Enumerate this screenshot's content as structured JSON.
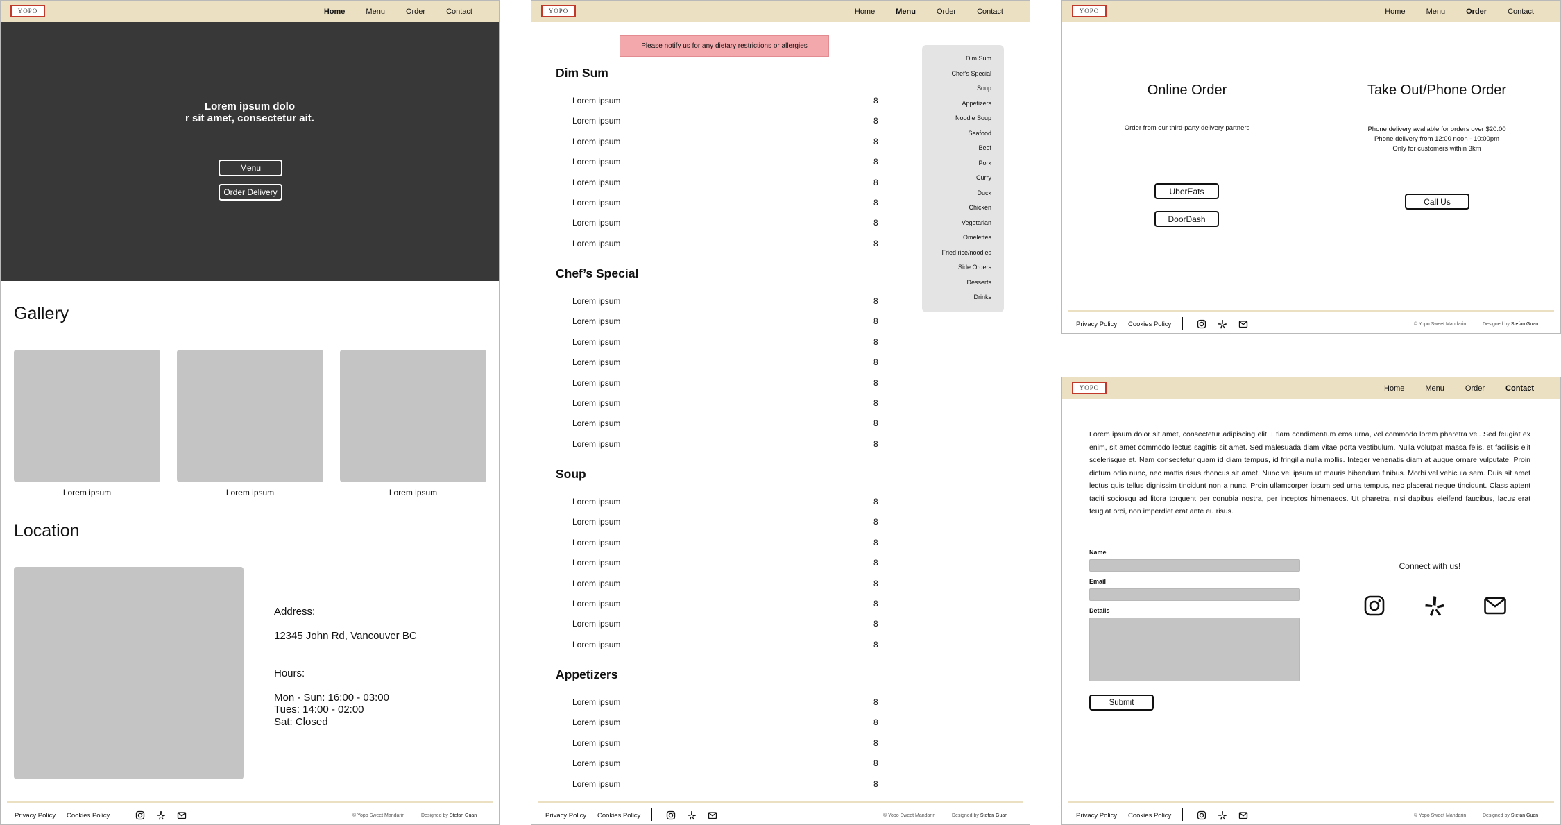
{
  "logo_text": "YOPO",
  "nav": {
    "home": "Home",
    "menu": "Menu",
    "order": "Order",
    "contact": "Contact"
  },
  "home": {
    "hero_title_line1": "Lorem ipsum dolo",
    "hero_title_line2": "r sit amet, consectetur ait.",
    "menu_button": "Menu",
    "order_delivery_button": "Order Delivery",
    "gallery_title": "Gallery",
    "gallery_captions": [
      "Lorem ipsum",
      "Lorem ipsum",
      "Lorem ipsum"
    ],
    "location_title": "Location",
    "address_label": "Address:",
    "address": "12345 John Rd, Vancouver BC",
    "hours_label": "Hours:",
    "hours": [
      "Mon - Sun: 16:00 - 03:00",
      "Tues: 14:00 - 02:00",
      "Sat: Closed"
    ]
  },
  "footer": {
    "privacy": "Privacy Policy",
    "cookies": "Cookies Policy",
    "copyright": "© Yopo Sweet Mandarin",
    "designed_by": "Designed by",
    "designer": "Stefan Guan"
  },
  "menu_page": {
    "allergy_notice": "Please notify us for any dietary restrictions or allergies",
    "categories": [
      {
        "title": "Dim Sum",
        "items": [
          {
            "name": "Lorem ipsum",
            "price": "8"
          },
          {
            "name": "Lorem ipsum",
            "price": "8"
          },
          {
            "name": "Lorem ipsum",
            "price": "8"
          },
          {
            "name": "Lorem ipsum",
            "price": "8"
          },
          {
            "name": "Lorem ipsum",
            "price": "8"
          },
          {
            "name": "Lorem ipsum",
            "price": "8"
          },
          {
            "name": "Lorem ipsum",
            "price": "8"
          },
          {
            "name": "Lorem ipsum",
            "price": "8"
          }
        ]
      },
      {
        "title": "Chef’s Special",
        "items": [
          {
            "name": "Lorem ipsum",
            "price": "8"
          },
          {
            "name": "Lorem ipsum",
            "price": "8"
          },
          {
            "name": "Lorem ipsum",
            "price": "8"
          },
          {
            "name": "Lorem ipsum",
            "price": "8"
          },
          {
            "name": "Lorem ipsum",
            "price": "8"
          },
          {
            "name": "Lorem ipsum",
            "price": "8"
          },
          {
            "name": "Lorem ipsum",
            "price": "8"
          },
          {
            "name": "Lorem ipsum",
            "price": "8"
          }
        ]
      },
      {
        "title": "Soup",
        "items": [
          {
            "name": "Lorem ipsum",
            "price": "8"
          },
          {
            "name": "Lorem ipsum",
            "price": "8"
          },
          {
            "name": "Lorem ipsum",
            "price": "8"
          },
          {
            "name": "Lorem ipsum",
            "price": "8"
          },
          {
            "name": "Lorem ipsum",
            "price": "8"
          },
          {
            "name": "Lorem ipsum",
            "price": "8"
          },
          {
            "name": "Lorem ipsum",
            "price": "8"
          },
          {
            "name": "Lorem ipsum",
            "price": "8"
          }
        ]
      },
      {
        "title": "Appetizers",
        "items": [
          {
            "name": "Lorem ipsum",
            "price": "8"
          },
          {
            "name": "Lorem ipsum",
            "price": "8"
          },
          {
            "name": "Lorem ipsum",
            "price": "8"
          },
          {
            "name": "Lorem ipsum",
            "price": "8"
          },
          {
            "name": "Lorem ipsum",
            "price": "8"
          }
        ]
      }
    ],
    "side_menu": [
      "Dim Sum",
      "Chef’s Special",
      "Soup",
      "Appetizers",
      "Noodle Soup",
      "Seafood",
      "Beef",
      "Pork",
      "Curry",
      "Duck",
      "Chicken",
      "Vegetarian",
      "Omelettes",
      "Fried rice/noodles",
      "Side Orders",
      "Desserts",
      "Drinks"
    ]
  },
  "order_page": {
    "online_title": "Online Order",
    "online_desc": "Order from our third-party delivery partners",
    "ubereats": "UberEats",
    "doordash": "DoorDash",
    "takeout_title": "Take Out/Phone Order",
    "takeout_lines": [
      "Phone delivery avaliable for orders over $20.00",
      "Phone delivery from 12:00 noon - 10:00pm",
      "Only for customers within 3km"
    ],
    "call_button": "Call Us"
  },
  "contact_page": {
    "paragraph": "Lorem ipsum dolor sit amet, consectetur adipiscing elit. Etiam condimentum eros urna, vel commodo lorem pharetra vel. Sed feugiat ex enim, sit amet commodo lectus sagittis sit amet. Sed malesuada diam vitae porta vestibulum. Nulla volutpat massa felis, et facilisis elit scelerisque et. Nam consectetur quam id diam tempus, id fringilla nulla mollis. Integer venenatis diam at augue ornare vulputate. Proin dictum odio nunc, nec mattis risus rhoncus sit amet. Nunc vel ipsum ut mauris bibendum finibus. Morbi vel vehicula sem. Duis sit amet lectus quis tellus dignissim tincidunt non a nunc. Proin ullamcorper ipsum sed urna tempus, nec placerat neque tincidunt. Class aptent taciti sociosqu ad litora torquent per conubia nostra, per inceptos himenaeos. Ut pharetra, nisi dapibus eleifend faucibus, lacus erat feugiat orci, non imperdiet erat ante eu risus.",
    "name_label": "Name",
    "email_label": "Email",
    "details_label": "Details",
    "submit": "Submit",
    "connect": "Connect with us!"
  },
  "icons": [
    "instagram-icon",
    "yelp-icon",
    "mail-icon"
  ]
}
